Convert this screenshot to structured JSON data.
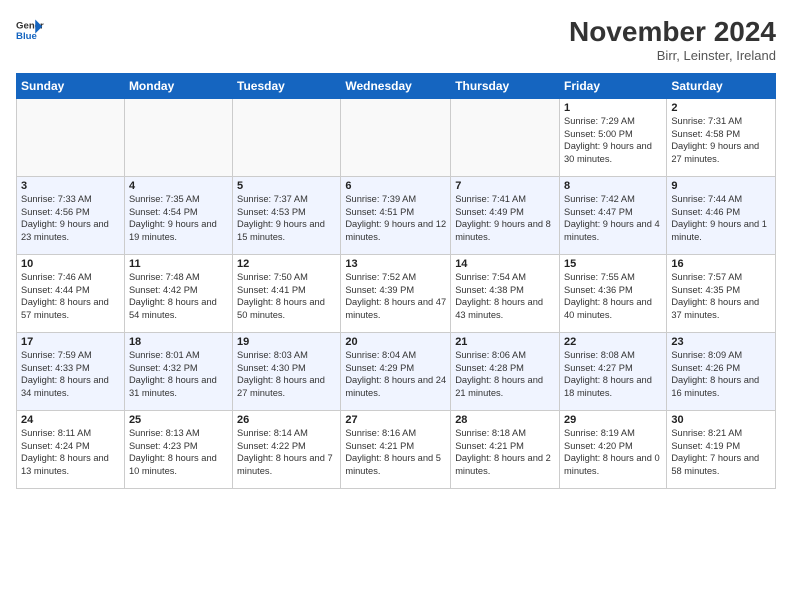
{
  "header": {
    "logo_general": "General",
    "logo_blue": "Blue",
    "title": "November 2024",
    "location": "Birr, Leinster, Ireland"
  },
  "days_of_week": [
    "Sunday",
    "Monday",
    "Tuesday",
    "Wednesday",
    "Thursday",
    "Friday",
    "Saturday"
  ],
  "weeks": [
    [
      {
        "day": "",
        "info": ""
      },
      {
        "day": "",
        "info": ""
      },
      {
        "day": "",
        "info": ""
      },
      {
        "day": "",
        "info": ""
      },
      {
        "day": "",
        "info": ""
      },
      {
        "day": "1",
        "info": "Sunrise: 7:29 AM\nSunset: 5:00 PM\nDaylight: 9 hours\nand 30 minutes."
      },
      {
        "day": "2",
        "info": "Sunrise: 7:31 AM\nSunset: 4:58 PM\nDaylight: 9 hours\nand 27 minutes."
      }
    ],
    [
      {
        "day": "3",
        "info": "Sunrise: 7:33 AM\nSunset: 4:56 PM\nDaylight: 9 hours\nand 23 minutes."
      },
      {
        "day": "4",
        "info": "Sunrise: 7:35 AM\nSunset: 4:54 PM\nDaylight: 9 hours\nand 19 minutes."
      },
      {
        "day": "5",
        "info": "Sunrise: 7:37 AM\nSunset: 4:53 PM\nDaylight: 9 hours\nand 15 minutes."
      },
      {
        "day": "6",
        "info": "Sunrise: 7:39 AM\nSunset: 4:51 PM\nDaylight: 9 hours\nand 12 minutes."
      },
      {
        "day": "7",
        "info": "Sunrise: 7:41 AM\nSunset: 4:49 PM\nDaylight: 9 hours\nand 8 minutes."
      },
      {
        "day": "8",
        "info": "Sunrise: 7:42 AM\nSunset: 4:47 PM\nDaylight: 9 hours\nand 4 minutes."
      },
      {
        "day": "9",
        "info": "Sunrise: 7:44 AM\nSunset: 4:46 PM\nDaylight: 9 hours\nand 1 minute."
      }
    ],
    [
      {
        "day": "10",
        "info": "Sunrise: 7:46 AM\nSunset: 4:44 PM\nDaylight: 8 hours\nand 57 minutes."
      },
      {
        "day": "11",
        "info": "Sunrise: 7:48 AM\nSunset: 4:42 PM\nDaylight: 8 hours\nand 54 minutes."
      },
      {
        "day": "12",
        "info": "Sunrise: 7:50 AM\nSunset: 4:41 PM\nDaylight: 8 hours\nand 50 minutes."
      },
      {
        "day": "13",
        "info": "Sunrise: 7:52 AM\nSunset: 4:39 PM\nDaylight: 8 hours\nand 47 minutes."
      },
      {
        "day": "14",
        "info": "Sunrise: 7:54 AM\nSunset: 4:38 PM\nDaylight: 8 hours\nand 43 minutes."
      },
      {
        "day": "15",
        "info": "Sunrise: 7:55 AM\nSunset: 4:36 PM\nDaylight: 8 hours\nand 40 minutes."
      },
      {
        "day": "16",
        "info": "Sunrise: 7:57 AM\nSunset: 4:35 PM\nDaylight: 8 hours\nand 37 minutes."
      }
    ],
    [
      {
        "day": "17",
        "info": "Sunrise: 7:59 AM\nSunset: 4:33 PM\nDaylight: 8 hours\nand 34 minutes."
      },
      {
        "day": "18",
        "info": "Sunrise: 8:01 AM\nSunset: 4:32 PM\nDaylight: 8 hours\nand 31 minutes."
      },
      {
        "day": "19",
        "info": "Sunrise: 8:03 AM\nSunset: 4:30 PM\nDaylight: 8 hours\nand 27 minutes."
      },
      {
        "day": "20",
        "info": "Sunrise: 8:04 AM\nSunset: 4:29 PM\nDaylight: 8 hours\nand 24 minutes."
      },
      {
        "day": "21",
        "info": "Sunrise: 8:06 AM\nSunset: 4:28 PM\nDaylight: 8 hours\nand 21 minutes."
      },
      {
        "day": "22",
        "info": "Sunrise: 8:08 AM\nSunset: 4:27 PM\nDaylight: 8 hours\nand 18 minutes."
      },
      {
        "day": "23",
        "info": "Sunrise: 8:09 AM\nSunset: 4:26 PM\nDaylight: 8 hours\nand 16 minutes."
      }
    ],
    [
      {
        "day": "24",
        "info": "Sunrise: 8:11 AM\nSunset: 4:24 PM\nDaylight: 8 hours\nand 13 minutes."
      },
      {
        "day": "25",
        "info": "Sunrise: 8:13 AM\nSunset: 4:23 PM\nDaylight: 8 hours\nand 10 minutes."
      },
      {
        "day": "26",
        "info": "Sunrise: 8:14 AM\nSunset: 4:22 PM\nDaylight: 8 hours\nand 7 minutes."
      },
      {
        "day": "27",
        "info": "Sunrise: 8:16 AM\nSunset: 4:21 PM\nDaylight: 8 hours\nand 5 minutes."
      },
      {
        "day": "28",
        "info": "Sunrise: 8:18 AM\nSunset: 4:21 PM\nDaylight: 8 hours\nand 2 minutes."
      },
      {
        "day": "29",
        "info": "Sunrise: 8:19 AM\nSunset: 4:20 PM\nDaylight: 8 hours\nand 0 minutes."
      },
      {
        "day": "30",
        "info": "Sunrise: 8:21 AM\nSunset: 4:19 PM\nDaylight: 7 hours\nand 58 minutes."
      }
    ]
  ]
}
